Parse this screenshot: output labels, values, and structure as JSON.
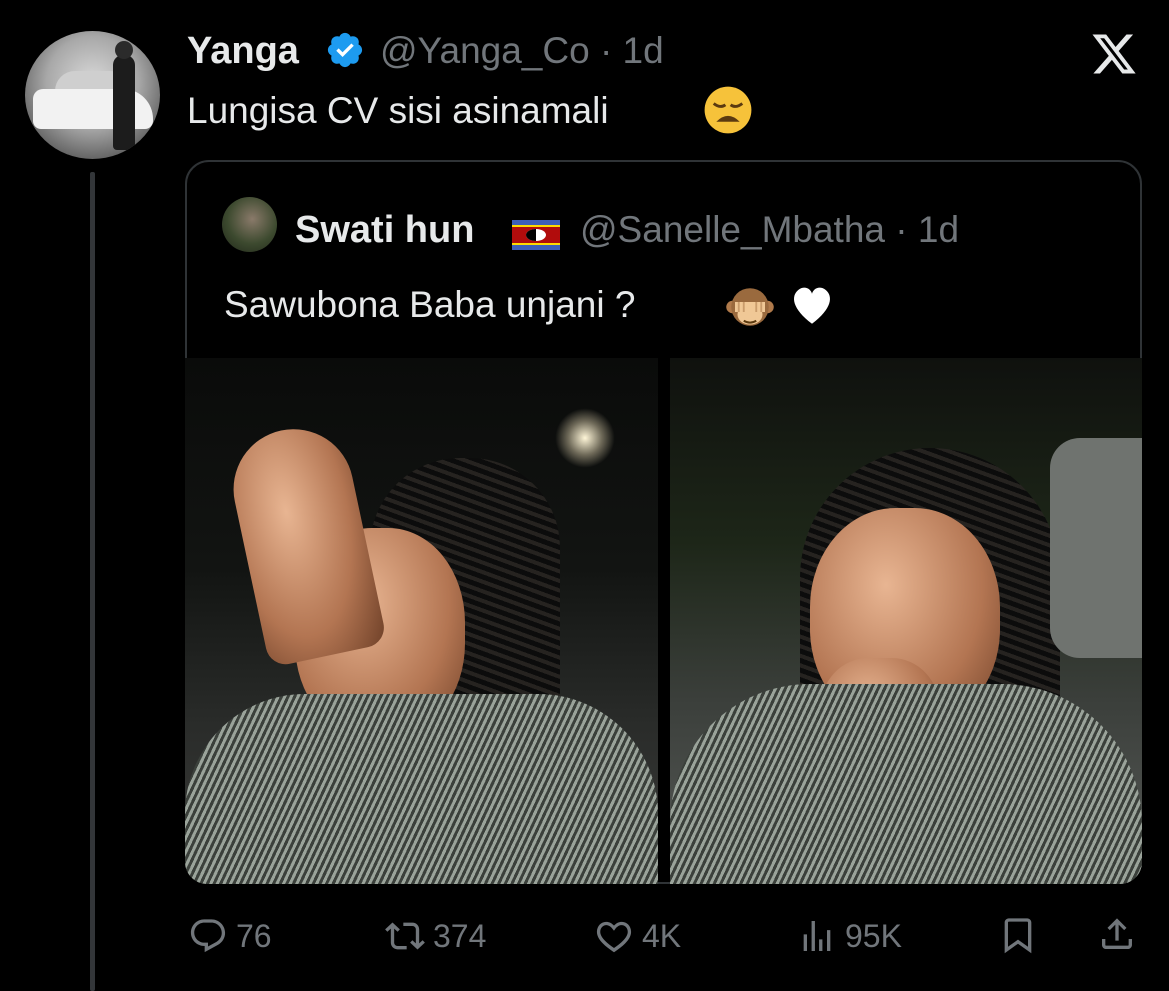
{
  "tweet": {
    "author_name": "Yanga",
    "author_handle": "@Yanga_Co · 1d",
    "text": "Lungisa CV sisi asinamali",
    "emoji": "weary-face"
  },
  "quoted": {
    "author_name": "Swati hun",
    "flag": "eswatini-flag",
    "author_handle": "@Sanelle_Mbatha · 1d",
    "text": "Sawubona Baba unjani ?",
    "emojis": [
      "see-no-evil-monkey",
      "white-heart"
    ]
  },
  "actions": {
    "replies": "76",
    "retweets": "374",
    "likes": "4K",
    "views": "95K"
  },
  "icons": {
    "verified": "verified-badge-icon",
    "logo": "x-logo-icon"
  },
  "colors": {
    "background": "#000000",
    "text": "#e7e9ea",
    "muted": "#71767b",
    "verified": "#1d9bf0",
    "border": "#2f3336"
  }
}
